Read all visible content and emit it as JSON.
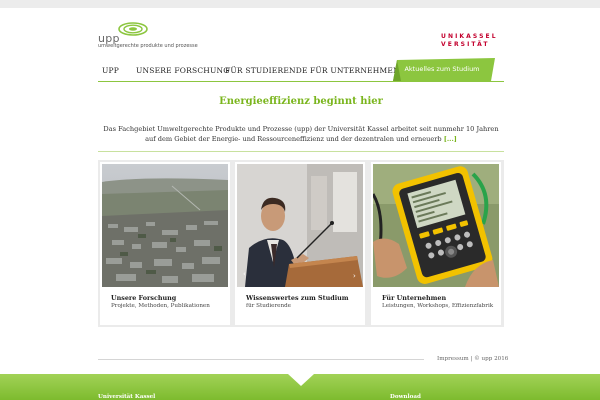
{
  "brand": {
    "logo_word": "upp",
    "logo_sub": "umweltgerechte produkte und prozesse",
    "uni_line1": "UNIKASSEL",
    "uni_line2": "VERSITÄT",
    "accent": "#8cc63f",
    "uni_red": "#c3002d"
  },
  "nav": {
    "items": [
      {
        "label": "UPP"
      },
      {
        "label": "UNSERE FORSCHUNG"
      },
      {
        "label": "FÜR STUDIERENDE"
      },
      {
        "label": "FÜR UNTERNEHMEN"
      }
    ],
    "cta_label": "Aktuelles zum Studium"
  },
  "main": {
    "headline": "Energieeffizienz beginnt hier",
    "intro": "Das Fachgebiet Umweltgerechte Produkte und Prozesse (upp) der Universität Kassel arbeitet seit nunmehr 10 Jahren auf dem Gebiet der Energie- und Ressourceneffizienz und der dezentralen und erneuerb",
    "intro_more": "[...]"
  },
  "cards": [
    {
      "title": "Unsere Forschung",
      "subtitle": "Projekte, Methoden, Publikationen",
      "image": "aerial-city-photo"
    },
    {
      "title": "Wissenswertes zum Studium",
      "subtitle": "für Studierende",
      "image": "lecturer-photo"
    },
    {
      "title": "Für Unternehmen",
      "subtitle": "Leistungen, Workshops, Effizienzfabrik",
      "image": "power-analyzer-photo"
    }
  ],
  "footer": {
    "meta": "Impressum | © upp 2016",
    "links": [
      "Universität Kassel",
      "Download"
    ]
  }
}
